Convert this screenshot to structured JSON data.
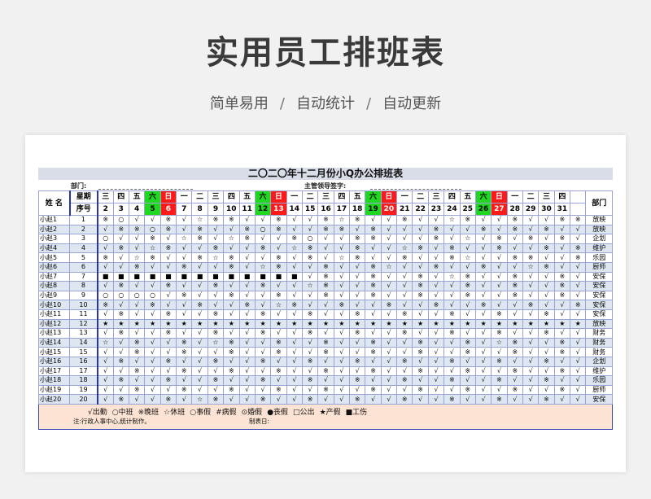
{
  "hero": {
    "title": "实用员工排班表",
    "features": [
      "简单易用",
      "自动统计",
      "自动更新"
    ],
    "separator": "/"
  },
  "sheet": {
    "title": "二〇二〇年十二月份小Q办公排班表",
    "dept_label": "部门:",
    "sign_label": "主管领导签字:",
    "name_header": "姓 名",
    "weekday_label": "星期",
    "seq_label": "序号",
    "dept_header": "部门",
    "days": [
      {
        "wd": "三",
        "d": "2",
        "t": "n"
      },
      {
        "wd": "四",
        "d": "3",
        "t": "n"
      },
      {
        "wd": "五",
        "d": "4",
        "t": "n"
      },
      {
        "wd": "六",
        "d": "5",
        "t": "sat"
      },
      {
        "wd": "日",
        "d": "6",
        "t": "sun"
      },
      {
        "wd": "一",
        "d": "7",
        "t": "n"
      },
      {
        "wd": "二",
        "d": "8",
        "t": "n"
      },
      {
        "wd": "三",
        "d": "9",
        "t": "n"
      },
      {
        "wd": "四",
        "d": "10",
        "t": "n"
      },
      {
        "wd": "五",
        "d": "11",
        "t": "n"
      },
      {
        "wd": "六",
        "d": "12",
        "t": "sat"
      },
      {
        "wd": "日",
        "d": "13",
        "t": "sun"
      },
      {
        "wd": "一",
        "d": "14",
        "t": "n"
      },
      {
        "wd": "二",
        "d": "15",
        "t": "n"
      },
      {
        "wd": "三",
        "d": "16",
        "t": "n"
      },
      {
        "wd": "四",
        "d": "17",
        "t": "n"
      },
      {
        "wd": "五",
        "d": "18",
        "t": "n"
      },
      {
        "wd": "六",
        "d": "19",
        "t": "sat"
      },
      {
        "wd": "日",
        "d": "20",
        "t": "sun"
      },
      {
        "wd": "一",
        "d": "21",
        "t": "n"
      },
      {
        "wd": "二",
        "d": "22",
        "t": "n"
      },
      {
        "wd": "三",
        "d": "23",
        "t": "n"
      },
      {
        "wd": "四",
        "d": "24",
        "t": "n"
      },
      {
        "wd": "五",
        "d": "25",
        "t": "n"
      },
      {
        "wd": "六",
        "d": "26",
        "t": "sat"
      },
      {
        "wd": "日",
        "d": "27",
        "t": "sun"
      },
      {
        "wd": "一",
        "d": "28",
        "t": "n"
      },
      {
        "wd": "二",
        "d": "29",
        "t": "n"
      },
      {
        "wd": "三",
        "d": "30",
        "t": "n"
      },
      {
        "wd": "四",
        "d": "31",
        "t": "n"
      },
      {
        "wd": "",
        "d": "",
        "t": "n"
      }
    ],
    "rows": [
      {
        "name": "小赵1",
        "seq": "1",
        "dept": "放映",
        "cells": "※○√√※√☆※※√√※√√※☆※√√※√√☆※√√※√√※※"
      },
      {
        "name": "小赵2",
        "seq": "2",
        "dept": "放映",
        "cells": "√※※○※√※√√※○※√√※※√※√√√※√√※√※√※√√"
      },
      {
        "name": "小赵3",
        "seq": "3",
        "dept": "企划",
        "cells": "○√√※√☆※√☆※√√※○√√※※√√√※√☆√※√※√※√"
      },
      {
        "name": "小赵4",
        "seq": "4",
        "dept": "维护",
        "cells": "√※√☆※√√※√√※√☆※√√※√√☆※√※√√※√√※√※"
      },
      {
        "name": "小赵5",
        "seq": "5",
        "dept": "乐园",
        "cells": "※√☆※√√※☆※√√※√※√☆※√√※√√※☆√√※※√√※"
      },
      {
        "name": "小赵6",
        "seq": "6",
        "dept": "厨师",
        "cells": "√√※√√※√√※√☆※√√※√√※☆√√※√√※√√☆※√√"
      },
      {
        "name": "小赵7",
        "seq": "7",
        "dept": "安保",
        "cells": "■■■■■■■■■■■■■√※√√※√√※√☆※√√※√√※√"
      },
      {
        "name": "小赵8",
        "seq": "8",
        "dept": "安保",
        "cells": "√※√√※√√※√√※√√☆※√√※√√※√√※√√※√√※√"
      },
      {
        "name": "小赵9",
        "seq": "9",
        "dept": "安保",
        "cells": "○○○○√※√√※√√※√√※√√※√√※√√※√√※√√※√"
      },
      {
        "name": "小赵10",
        "seq": "10",
        "dept": "安保",
        "cells": "※√√※√√※√√※√☆※√√※√√※√√※√√※√√※√√※"
      },
      {
        "name": "小赵11",
        "seq": "11",
        "dept": "安保",
        "cells": "√※√√※√√※√√※√√※√√※√√※√√※√√※√√※√√"
      },
      {
        "name": "小赵12",
        "seq": "12",
        "dept": "放映",
        "cells": "★★★★★★★★★★★★★★★★★★★★★★★★★★★★★★★"
      },
      {
        "name": "小赵13",
        "seq": "13",
        "dept": "财务",
        "cells": "√※√√※√√※√√※√√※√√※√√※√√※√√※√√※√√"
      },
      {
        "name": "小赵14",
        "seq": "14",
        "dept": "财务",
        "cells": "☆√※√√※√☆※√√※√√※√√※√√※√√※√☆※√√※√"
      },
      {
        "name": "小赵15",
        "seq": "15",
        "dept": "财务",
        "cells": "√√※√√※√√※√√※√√※√√※√√※√√※√√※√√※√"
      },
      {
        "name": "小赵16",
        "seq": "16",
        "dept": "企划",
        "cells": "√※√√※√√※√√※√√※√√※√√※√√※√√※√√※√√"
      },
      {
        "name": "小赵17",
        "seq": "17",
        "dept": "维护",
        "cells": "√√※√√※√√※√√※√√※√√※√√※√√※√√※√√※√"
      },
      {
        "name": "小赵18",
        "seq": "18",
        "dept": "乐园",
        "cells": "√※√√※√√※√√※√√※√√※√√※√√※√√※√√※√√"
      },
      {
        "name": "小赵19",
        "seq": "19",
        "dept": "厨师",
        "cells": "√√※√√※√√※√√※√√※√√※√√※√√※√√※√√※√"
      },
      {
        "name": "小赵20",
        "seq": "20",
        "dept": "安保",
        "cells": "√※√√※√☆※√√※√√※√√※√√※√√※√√※√√※√√"
      }
    ],
    "legend": [
      "√出勤",
      "○中班",
      "※晚班",
      "☆休班",
      "○事假",
      "#病假",
      "⊙婚假",
      "●丧假",
      "□公出",
      "★产假",
      "■工伤"
    ],
    "note": "注:行政人事中心,统计制作。",
    "date_label": "制表日:"
  }
}
